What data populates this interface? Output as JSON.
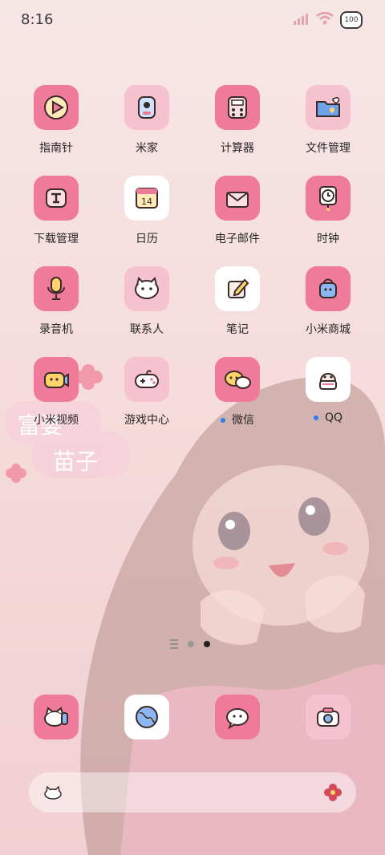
{
  "status": {
    "time": "8:16",
    "battery": "100"
  },
  "wallpaper_text": [
    "富婆",
    "苗子"
  ],
  "apps": [
    {
      "name": "指南针",
      "icon": "compass-icon",
      "style": "pink",
      "dot": false
    },
    {
      "name": "米家",
      "icon": "mijia-icon",
      "style": "lpink",
      "dot": false
    },
    {
      "name": "计算器",
      "icon": "calculator-icon",
      "style": "pink",
      "dot": false
    },
    {
      "name": "文件管理",
      "icon": "folder-icon",
      "style": "lpink",
      "dot": false
    },
    {
      "name": "下载管理",
      "icon": "download-icon",
      "style": "pink",
      "dot": false
    },
    {
      "name": "日历",
      "icon": "calendar-icon",
      "style": "white",
      "dot": false,
      "day": "14"
    },
    {
      "name": "电子邮件",
      "icon": "mail-icon",
      "style": "pink",
      "dot": false
    },
    {
      "name": "时钟",
      "icon": "clock-icon",
      "style": "pink",
      "dot": false
    },
    {
      "name": "录音机",
      "icon": "recorder-icon",
      "style": "pink",
      "dot": false
    },
    {
      "name": "联系人",
      "icon": "contacts-icon",
      "style": "lpink",
      "dot": false
    },
    {
      "name": "笔记",
      "icon": "notes-icon",
      "style": "white",
      "dot": false
    },
    {
      "name": "小米商城",
      "icon": "store-icon",
      "style": "pink",
      "dot": false
    },
    {
      "name": "小米视频",
      "icon": "video-icon",
      "style": "pink",
      "dot": false
    },
    {
      "name": "游戏中心",
      "icon": "game-icon",
      "style": "lpink",
      "dot": false
    },
    {
      "name": "微信",
      "icon": "wechat-icon",
      "style": "pink",
      "dot": true
    },
    {
      "name": "QQ",
      "icon": "qq-icon",
      "style": "white",
      "dot": true
    }
  ],
  "dock": [
    {
      "icon": "phone-icon",
      "style": "pink"
    },
    {
      "icon": "browser-icon",
      "style": "white"
    },
    {
      "icon": "messages-icon",
      "style": "pink"
    },
    {
      "icon": "camera-icon",
      "style": "lpink"
    }
  ],
  "page_indicator": {
    "pages": 2,
    "active": 2
  }
}
